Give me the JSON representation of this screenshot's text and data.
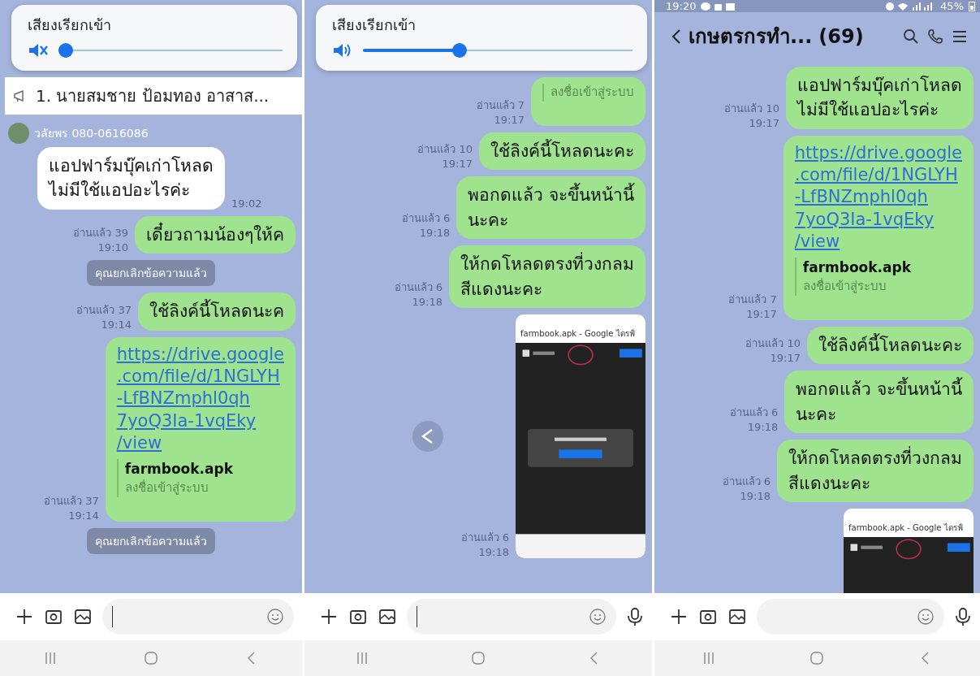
{
  "panels": [
    {
      "volume_popup": {
        "title": "เสียงเรียกเข้า",
        "muted": true,
        "level": 0.0
      },
      "announcement": "1. นายสมชาย ป้อมทอง อาสาส...",
      "messages": [
        {
          "kind": "incoming",
          "sender": "วลัยพร 080-0616086",
          "text": "แอปฟาร์มบุ๊คเก่าโหลด\nไม่มีใช้แอปอะไรค่ะ",
          "time": "19:02"
        },
        {
          "kind": "outgoing",
          "read": "อ่านแล้ว 39",
          "time": "19:10",
          "text": "เดี๋ยวถามน้องๆให้ค"
        },
        {
          "kind": "system",
          "text": "คุณยกเลิกข้อความแล้ว"
        },
        {
          "kind": "outgoing",
          "read": "อ่านแล้ว 37",
          "time": "19:14",
          "text": "ใช้ลิงค์นี้โหลดนะค"
        },
        {
          "kind": "link",
          "read": "อ่านแล้ว 37",
          "time": "19:14",
          "url": "https://drive.google\n.com/file/d/1NGLYH\n-LfBNZmphl0qh\n7yoQ3Ia-1vqEky\n/view",
          "file_name": "farmbook.apk",
          "subtitle": "ลงชื่อเข้าสู่ระบบ"
        },
        {
          "kind": "system",
          "text": "คุณยกเลิกข้อความแล้ว"
        }
      ],
      "composer": {
        "focused": true
      }
    },
    {
      "volume_popup": {
        "title": "เสียงเรียกเข้า",
        "muted": false,
        "level": 0.35
      },
      "messages": [
        {
          "kind": "link",
          "read": "อ่านแล้ว 7",
          "time": "19:17",
          "subtitle": "ลงชื่อเข้าสู่ระบบ"
        },
        {
          "kind": "outgoing",
          "read": "อ่านแล้ว 10",
          "time": "19:17",
          "text": "ใช้ลิงค์นี้โหลดนะคะ"
        },
        {
          "kind": "outgoing",
          "read": "อ่านแล้ว 6",
          "time": "19:18",
          "text": "พอกดแล้ว จะขึ้นหน้านี้\nนะคะ"
        },
        {
          "kind": "outgoing",
          "read": "อ่านแล้ว 6",
          "time": "19:18",
          "text": "ให้กดโหลดตรงที่วงกลม\nสีแดงนะคะ"
        },
        {
          "kind": "image",
          "read": "อ่านแล้ว 6",
          "time": "19:18",
          "caption": "farmbook.apk - Google ไดรฟ์",
          "share": true
        }
      ],
      "composer": {
        "focused": true,
        "mic": true
      }
    },
    {
      "status_bar": {
        "time": "19:20",
        "battery": "45%"
      },
      "header": {
        "title": "เกษตรกรทำ...",
        "count": "(69)"
      },
      "messages": [
        {
          "kind": "outgoing",
          "read": "อ่านแล้ว 10",
          "time": "19:17",
          "text": "แอปฟาร์มบุ๊คเก่าโหลด\nไม่มีใช้แอปอะไรค่ะ"
        },
        {
          "kind": "link",
          "read": "อ่านแล้ว 7",
          "time": "19:17",
          "url": "https://drive.google\n.com/file/d/1NGLYH\n-LfBNZmphl0qh\n7yoQ3Ia-1vqEky\n/view",
          "file_name": "farmbook.apk",
          "subtitle": "ลงชื่อเข้าสู่ระบบ"
        },
        {
          "kind": "outgoing",
          "read": "อ่านแล้ว 10",
          "time": "19:17",
          "text": "ใช้ลิงค์นี้โหลดนะคะ"
        },
        {
          "kind": "outgoing",
          "read": "อ่านแล้ว 6",
          "time": "19:18",
          "text": "พอกดแล้ว จะขึ้นหน้านี้\nนะคะ"
        },
        {
          "kind": "outgoing",
          "read": "อ่านแล้ว 6",
          "time": "19:18",
          "text": "ให้กดโหลดตรงที่วงกลม\nสีแดงนะคะ"
        },
        {
          "kind": "image",
          "caption": "farmbook.apk - Google ไดรฟ์"
        }
      ],
      "composer": {
        "mic": true
      }
    }
  ]
}
